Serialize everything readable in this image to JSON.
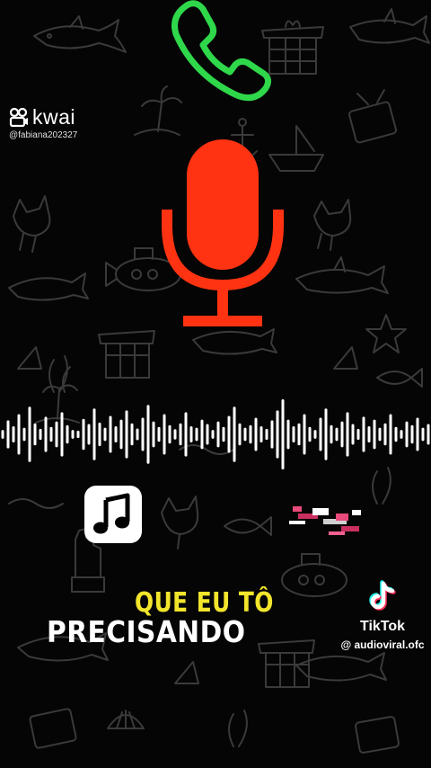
{
  "kwai": {
    "brand": "kwai",
    "username": "@fabiana202327"
  },
  "captions": {
    "line1": "QUE EU TÔ",
    "line2": "PRECISANDO"
  },
  "tiktok": {
    "brand": "TikTok",
    "username": "@ audioviral.ofc"
  },
  "colors": {
    "background": "#050505",
    "doodle": "#3a3a3a",
    "phone_icon": "#2fd84a",
    "microphone": "#ff3311",
    "caption_yellow": "#f2e52c",
    "caption_white": "#ffffff",
    "waveform": "#ffffff"
  },
  "icons": [
    "phone-icon",
    "microphone-icon",
    "music-note-icon",
    "tiktok-icon",
    "kwai-icon",
    "audio-waveform"
  ],
  "waveform_levels": [
    0.12,
    0.38,
    0.22,
    0.55,
    0.18,
    0.75,
    0.3,
    0.15,
    0.48,
    0.2,
    0.35,
    0.6,
    0.25,
    0.12,
    0.1,
    0.42,
    0.28,
    0.7,
    0.32,
    0.18,
    0.5,
    0.22,
    0.4,
    0.65,
    0.3,
    0.16,
    0.45,
    0.8,
    0.35,
    0.2,
    0.55,
    0.25,
    0.14,
    0.3,
    0.6,
    0.22,
    0.18,
    0.4,
    0.28,
    0.12,
    0.35,
    0.2,
    0.5,
    0.75,
    0.3,
    0.18,
    0.25,
    0.45,
    0.22,
    0.15,
    0.38,
    0.65,
    0.95,
    0.4,
    0.22,
    0.3,
    0.55,
    0.2,
    0.12,
    0.45,
    0.7,
    0.25,
    0.18,
    0.35,
    0.6,
    0.28,
    0.15,
    0.48,
    0.22,
    0.4,
    0.18,
    0.3,
    0.55,
    0.2,
    0.12,
    0.35,
    0.25,
    0.45,
    0.18,
    0.28
  ]
}
